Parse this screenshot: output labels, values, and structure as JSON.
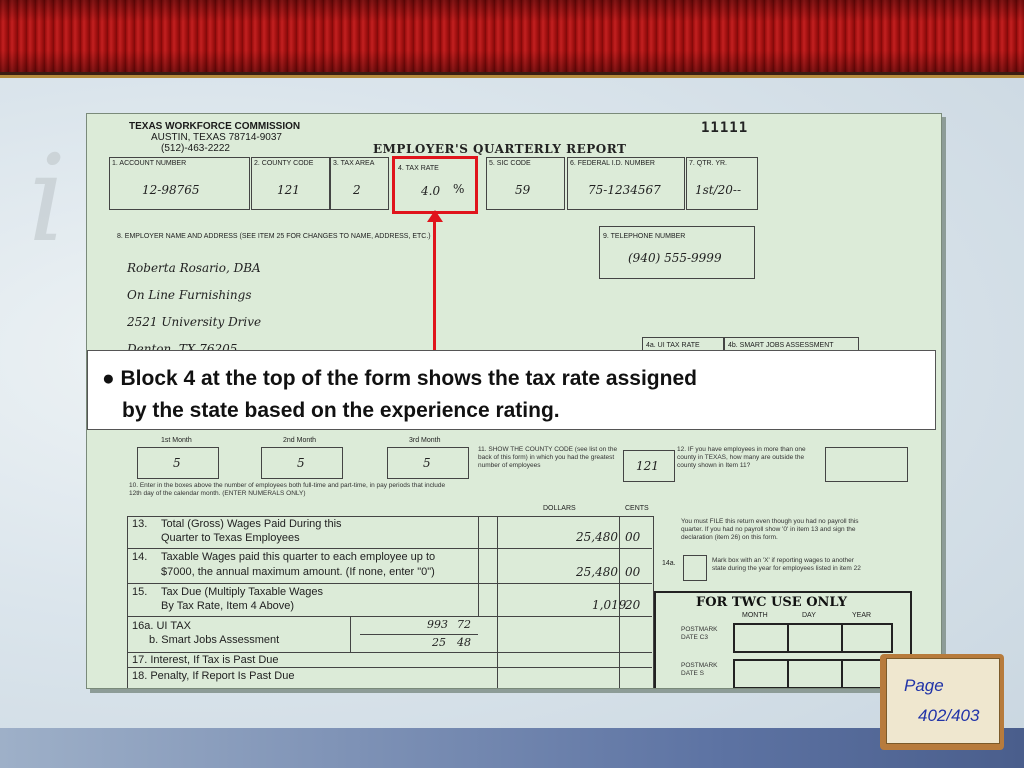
{
  "form": {
    "agency": [
      "TEXAS WORKFORCE COMMISSION",
      "AUSTIN, TEXAS 78714-9037",
      "(512)-463-2222"
    ],
    "title": "EMPLOYER'S QUARTERLY REPORT",
    "form_number": "11111",
    "top_boxes": [
      {
        "label": "1. ACCOUNT NUMBER",
        "value": "12-98765"
      },
      {
        "label": "2. COUNTY CODE",
        "value": "121"
      },
      {
        "label": "3. TAX AREA",
        "value": "2"
      },
      {
        "label": "4. TAX RATE",
        "value": "4.0",
        "unit": "%"
      },
      {
        "label": "5. SIC CODE",
        "value": "59"
      },
      {
        "label": "6. FEDERAL I.D. NUMBER",
        "value": "75-1234567"
      },
      {
        "label": "7. QTR. YR.",
        "value": "1st/20--"
      }
    ],
    "employer_label": "8. EMPLOYER NAME AND ADDRESS (SEE ITEM 25 FOR CHANGES TO NAME, ADDRESS, ETC.)",
    "employer_lines": [
      "Roberta Rosario, DBA",
      "On Line Furnishings",
      "2521 University Drive",
      "Denton, TX 76205"
    ],
    "phone_label": "9. TELEPHONE NUMBER",
    "phone_value": "(940) 555-9999",
    "rate_labels": [
      "4a. UI TAX RATE",
      "4b. SMART JOBS ASSESSMENT"
    ],
    "months": [
      {
        "label": "1st Month",
        "value": "5"
      },
      {
        "label": "2nd Month",
        "value": "5"
      },
      {
        "label": "3rd Month",
        "value": "5"
      }
    ],
    "item11_text": "11. SHOW THE COUNTY CODE (see list on the back of this form) in which you had the greatest number of employees",
    "item11_value": "121",
    "item12_text": "12. IF you have employees in more than one county in TEXAS, how many are outside the county shown in Item 11?",
    "item10_text": "10. Enter in the boxes above the number of employees both full-time and part-time, in pay periods that include 12th day of the calendar month. (ENTER NUMERALS ONLY)",
    "col_dollars": "DOLLARS",
    "col_cents": "CENTS",
    "rows": [
      {
        "num": "13.",
        "line1": "Total (Gross) Wages Paid During this",
        "line2": "Quarter to Texas Employees",
        "dollars": "25,480",
        "cents": "00"
      },
      {
        "num": "14.",
        "line1": "Taxable Wages paid this quarter to each employee up to",
        "line2": "$7000, the annual maximum amount. (If none, enter \"0\")",
        "dollars": "25,480",
        "cents": "00"
      },
      {
        "num": "15.",
        "line1": "Tax Due (Multiply Taxable Wages",
        "line2": "By Tax Rate, Item 4 Above)",
        "dollars": "1,019",
        "cents": "20"
      }
    ],
    "row16a": {
      "label": "16a. UI TAX",
      "dollars": "993",
      "cents": "72"
    },
    "row16b": {
      "label": "b. Smart Jobs Assessment",
      "dollars": "25",
      "cents": "48"
    },
    "row17": "17.   Interest, If Tax is Past Due",
    "row18": "18.   Penalty, If Report Is Past Due",
    "file_note": "You must FILE this return even though you had no payroll this quarter. If you had no payroll show '0' in item 13 and sign the declaration (item 26) on this form.",
    "item14a_label": "14a.",
    "item14a_text": "Mark box with an 'X' if reporting wages to another state during the year for employees listed in item 22",
    "twc": {
      "title": "FOR TWC USE ONLY",
      "cols": [
        "MONTH",
        "DAY",
        "YEAR"
      ],
      "postmark_c": "POSTMARK DATE  C3",
      "postmark_s": "POSTMARK DATE  S"
    }
  },
  "callout": {
    "line1": "● Block 4 at the top of the form shows the tax rate assigned",
    "line2": "by the state based on the experience rating."
  },
  "page": {
    "label": "Page",
    "number": "402/403"
  },
  "colors": {
    "highlight": "#e0141c",
    "form_bg": "#dcebd8",
    "header_red": "#a51212",
    "page_text": "#2133a8"
  }
}
